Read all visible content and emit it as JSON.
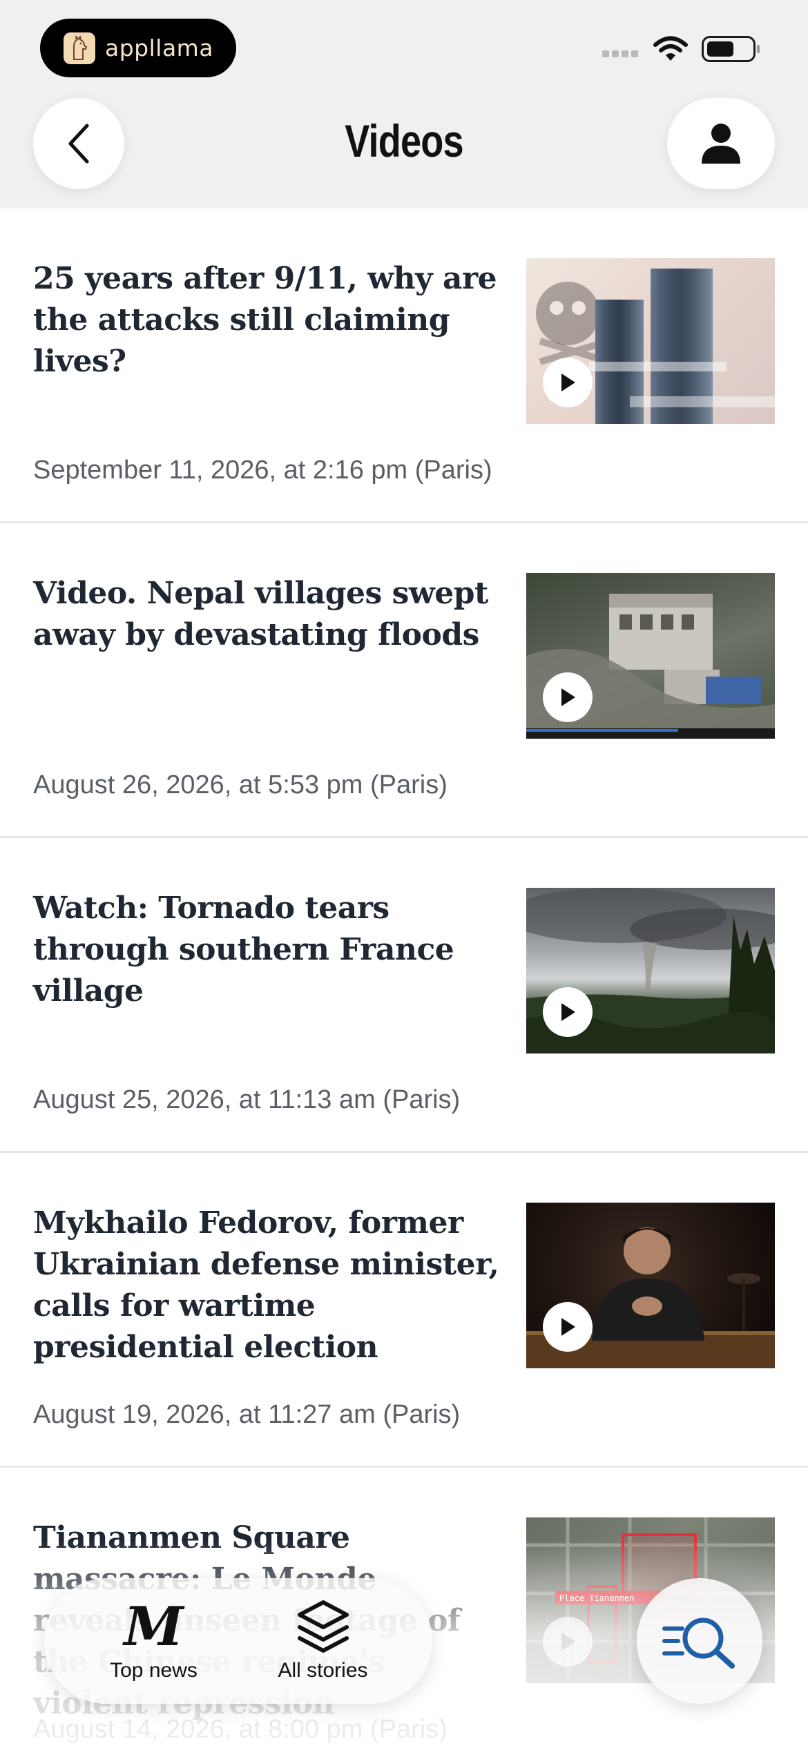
{
  "status_bar": {
    "brand_name": "appllama"
  },
  "header": {
    "title": "Videos",
    "back_icon": "chevron-left-icon",
    "account_icon": "person-icon"
  },
  "articles": [
    {
      "headline": "25 years after 9/11, why are the attacks still claiming lives?",
      "date": "September 11, 2026, at 2:16 pm (Paris)",
      "thumbnail": "twin-towers-illustration"
    },
    {
      "headline": "Video. Nepal villages swept away by devastating floods",
      "date": "August 26, 2026, at 5:53 pm (Paris)",
      "thumbnail": "flood-village"
    },
    {
      "headline": "Watch: Tornado tears through southern France village",
      "date": "August 25, 2026, at 11:13 am (Paris)",
      "thumbnail": "tornado-sky"
    },
    {
      "headline": "Mykhailo Fedorov, former Ukrainian defense minister, calls for wartime presidential election",
      "date": "August 19, 2026, at 11:27 am (Paris)",
      "thumbnail": "man-at-desk"
    },
    {
      "headline": "Tiananmen Square massacre: Le Monde reveals unseen footage of the Chinese regime's violent repression",
      "date": "August 14, 2026, at 8:00 pm (Paris)",
      "thumbnail": "satellite-map",
      "thumb_label": "Place Tiananmen"
    }
  ],
  "tabbar": {
    "top_news_label": "Top news",
    "all_stories_label": "All stories"
  },
  "colors": {
    "headline": "#1f2733",
    "date": "#5a5f66",
    "header_bg": "#f0f0f2",
    "accent_blue": "#1f5fa8"
  }
}
